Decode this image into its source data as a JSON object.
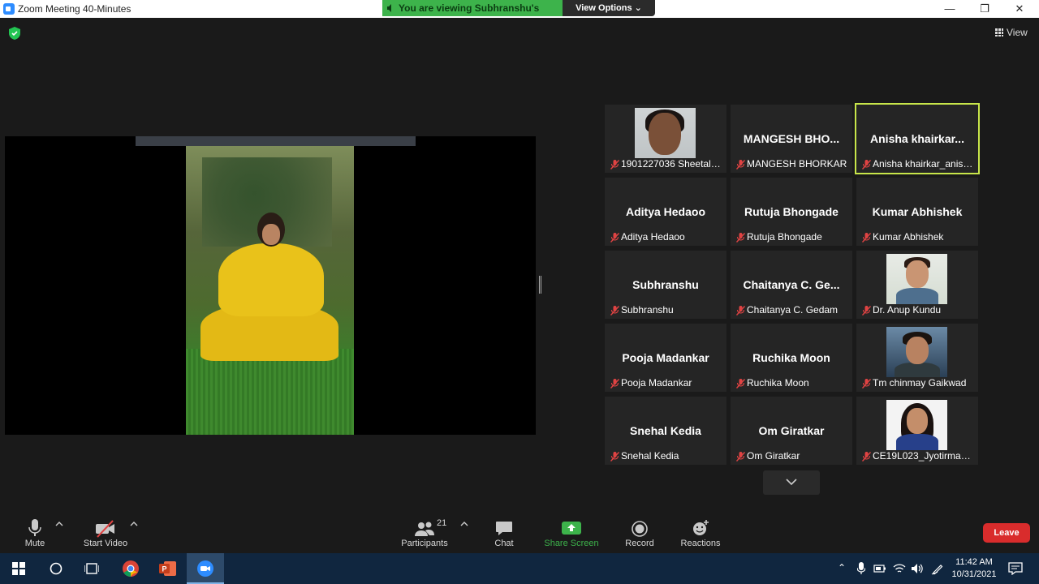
{
  "window": {
    "title": "Zoom Meeting 40-Minutes"
  },
  "banner": {
    "viewing_text": "You are viewing Subhranshu's screen",
    "view_options": "View Options"
  },
  "top_right": {
    "view_label": "View"
  },
  "gallery": {
    "tiles": [
      {
        "big_name": "",
        "label": "1901227036 Sheetal ...",
        "photo": "a"
      },
      {
        "big_name": "MANGESH  BHO...",
        "label": "MANGESH BHORKAR",
        "photo": ""
      },
      {
        "big_name": "Anisha  khairkar...",
        "label": "Anisha khairkar_anish...",
        "photo": "",
        "active": true
      },
      {
        "big_name": "Aditya Hedaoo",
        "label": "Aditya Hedaoo",
        "photo": ""
      },
      {
        "big_name": "Rutuja Bhongade",
        "label": "Rutuja Bhongade",
        "photo": ""
      },
      {
        "big_name": "Kumar Abhishek",
        "label": "Kumar Abhishek",
        "photo": ""
      },
      {
        "big_name": "Subhranshu",
        "label": "Subhranshu",
        "photo": ""
      },
      {
        "big_name": "Chaitanya  C. Ge...",
        "label": "Chaitanya C. Gedam",
        "photo": ""
      },
      {
        "big_name": "",
        "label": "Dr. Anup Kundu",
        "photo": "b"
      },
      {
        "big_name": "Pooja Madankar",
        "label": "Pooja Madankar",
        "photo": ""
      },
      {
        "big_name": "Ruchika Moon",
        "label": "Ruchika Moon",
        "photo": ""
      },
      {
        "big_name": "",
        "label": "Tm chinmay Gaikwad",
        "photo": "c"
      },
      {
        "big_name": "Snehal Kedia",
        "label": "Snehal Kedia",
        "photo": ""
      },
      {
        "big_name": "Om Giratkar",
        "label": "Om Giratkar",
        "photo": ""
      },
      {
        "big_name": "",
        "label": "CE19L023_Jyotirmaye...",
        "photo": "d"
      }
    ]
  },
  "toolbar": {
    "mute": "Mute",
    "start_video": "Start Video",
    "participants": "Participants",
    "participants_count": "21",
    "chat": "Chat",
    "share_screen": "Share Screen",
    "record": "Record",
    "reactions": "Reactions",
    "leave": "Leave"
  },
  "taskbar": {
    "time": "11:42 AM",
    "date": "10/31/2021"
  },
  "colors": {
    "share_green": "#3db34b",
    "leave_red": "#d92c2c",
    "active_outline": "#c8e64a",
    "taskbar": "#10263f"
  }
}
